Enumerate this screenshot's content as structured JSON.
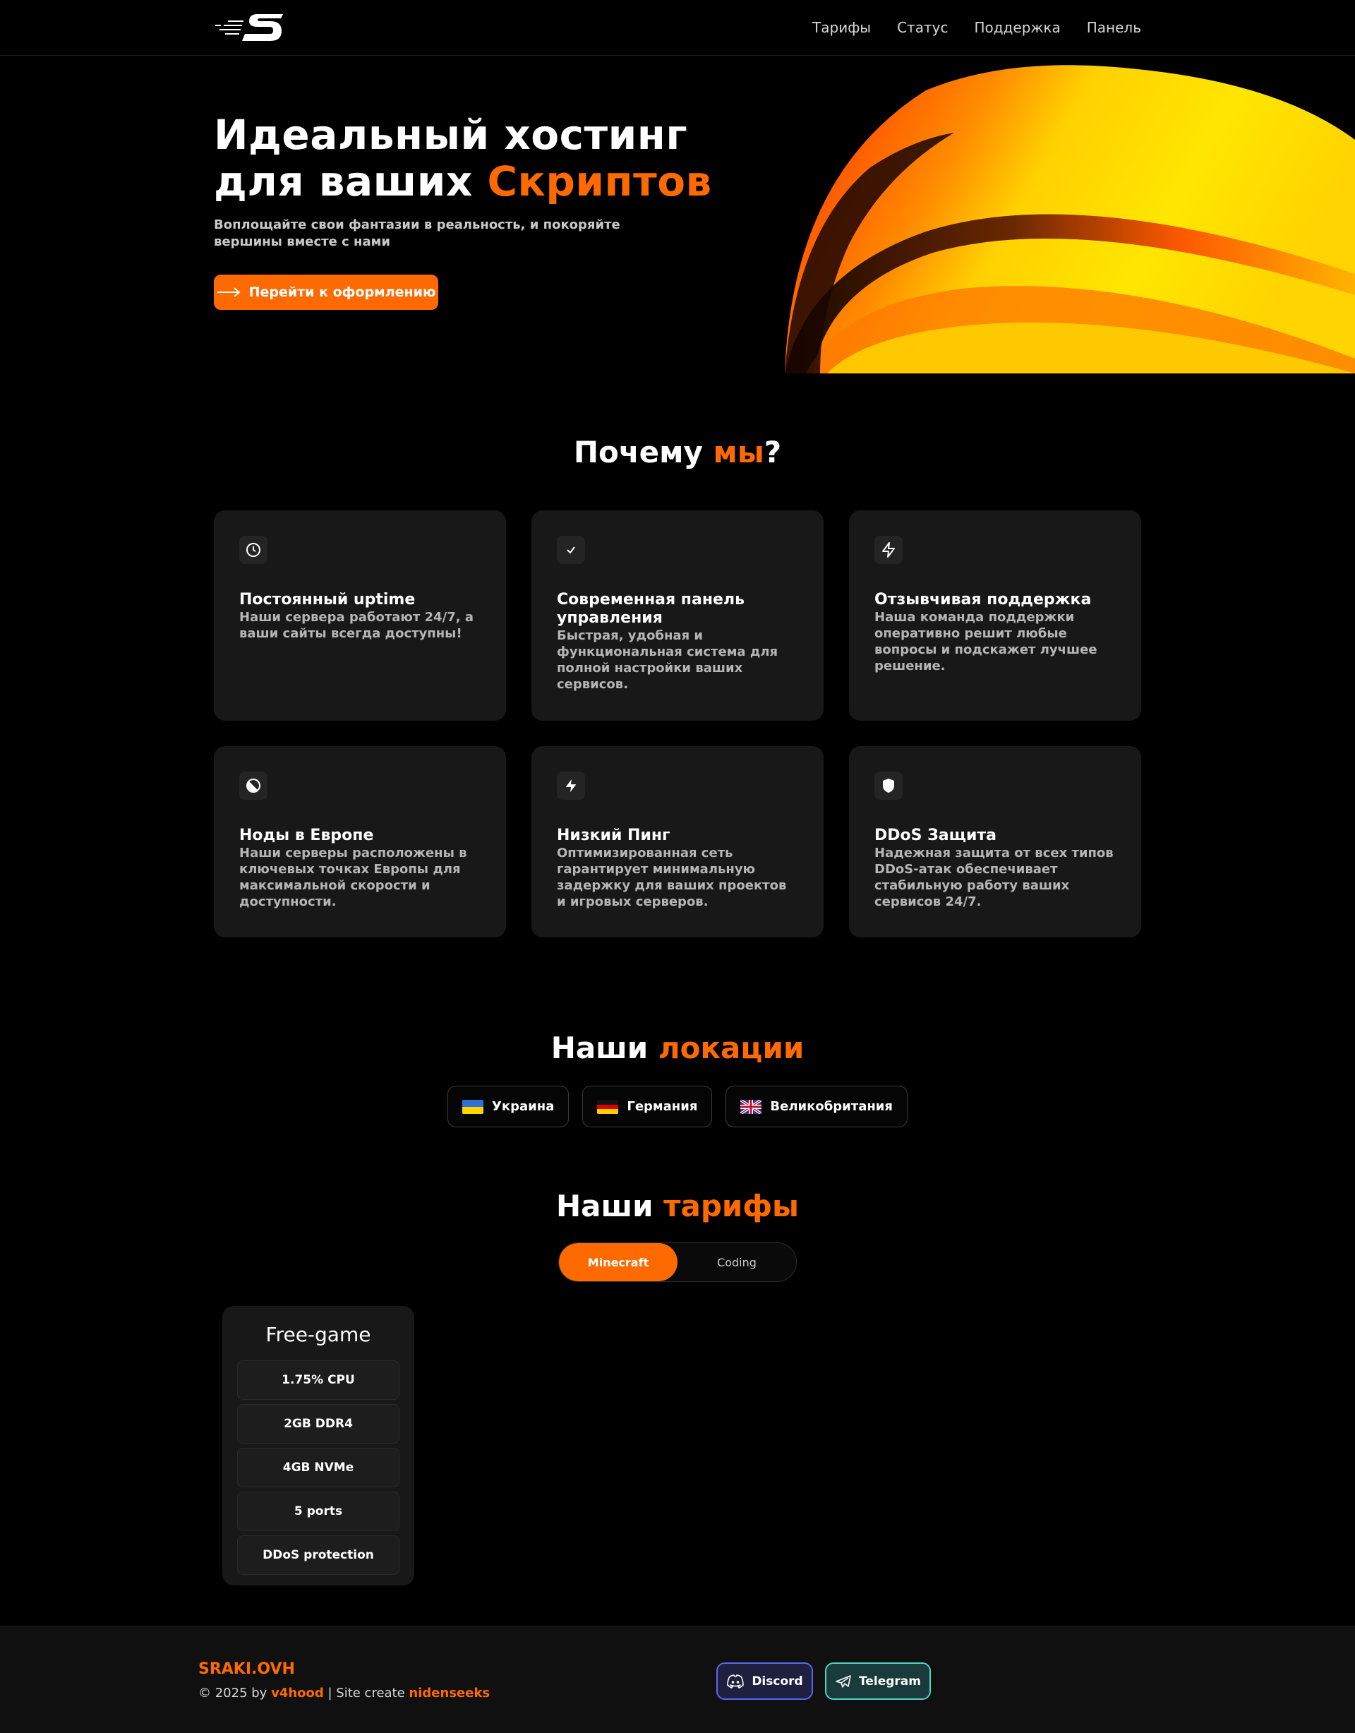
{
  "nav": {
    "items": [
      "Тарифы",
      "Статус",
      "Поддержка",
      "Панель"
    ]
  },
  "hero": {
    "title_line1": "Идеальный хостинг",
    "title_line2_prefix": "для ваших ",
    "title_line2_accent": "Скриптов",
    "subtitle": "Воплощайте свои фантазии в реальность, и покоряйте вершины вместе с нами",
    "cta_label": "Перейти к оформлению"
  },
  "why": {
    "title_prefix": "Почему ",
    "title_accent": "мы",
    "title_suffix": "?",
    "cards": [
      {
        "icon": "clock-icon",
        "title": "Постоянный uptime",
        "text": "Наши сервера работают 24/7, а ваши сайты всегда доступны!"
      },
      {
        "icon": "check-icon",
        "title": "Современная панель управления",
        "text": "Быстрая, удобная и функциональная система для полной настройки ваших сервисов."
      },
      {
        "icon": "lightning-outline-icon",
        "title": "Отзывчивая поддержка",
        "text": "Наша команда поддержки оперативно решит любые вопросы и подскажет лучшее решение."
      },
      {
        "icon": "globe-icon",
        "title": "Ноды в Европе",
        "text": "Наши серверы расположены в ключевых точках Европы для максимальной скорости и доступности."
      },
      {
        "icon": "lightning-filled-icon",
        "title": "Низкий Пинг",
        "text": "Оптимизированная сеть гарантирует минимальную задержку для ваших проектов и игровых серверов."
      },
      {
        "icon": "shield-icon",
        "title": "DDoS Защита",
        "text": "Надежная защита от всех типов DDoS-атак обеспечивает стабильную работу ваших сервисов 24/7."
      }
    ]
  },
  "locations": {
    "title_prefix": "Наши ",
    "title_accent": "локации",
    "items": [
      {
        "flag": "ukraine-flag-icon",
        "label": "Украина"
      },
      {
        "flag": "germany-flag-icon",
        "label": "Германия"
      },
      {
        "flag": "uk-flag-icon",
        "label": "Великобритания"
      }
    ]
  },
  "tariffs": {
    "title_prefix": "Наши ",
    "title_accent": "тарифы",
    "tabs": [
      {
        "label": "Minecraft",
        "active": true
      },
      {
        "label": "Coding",
        "active": false
      }
    ],
    "plans": [
      {
        "name": "Free-game",
        "features": [
          "1.75% CPU",
          "2GB DDR4",
          "4GB NVMe",
          "5 ports",
          "DDoS protection"
        ]
      }
    ]
  },
  "footer": {
    "brand": "SRAKI.OVH",
    "copy_prefix": "© 2025 by ",
    "author": "v4hood",
    "copy_middle": " | Site create ",
    "creator": "nidenseeks",
    "discord_label": "Discord",
    "telegram_label": "Telegram"
  },
  "colors": {
    "accent": "#ff6a00",
    "background": "#000000",
    "card": "#181818",
    "discord": "#5865f2",
    "telegram": "#4fd3c4"
  }
}
